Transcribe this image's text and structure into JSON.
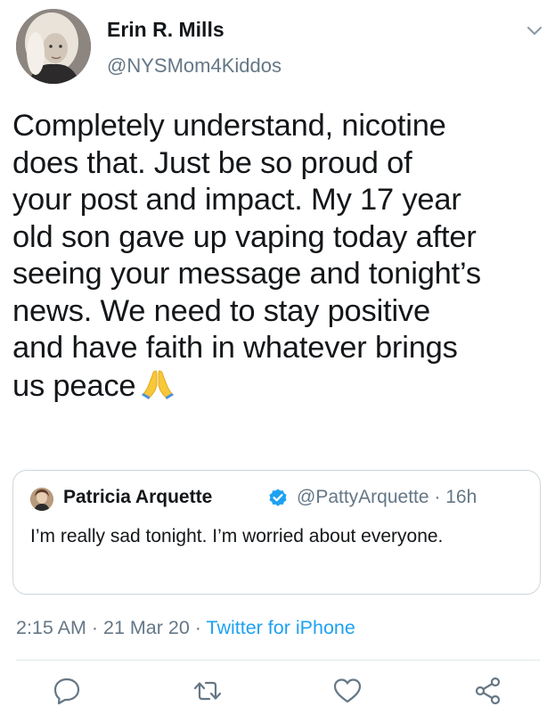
{
  "author": {
    "name": "Erin R. Mills",
    "handle": "@NYSMom4Kiddos"
  },
  "tweet": {
    "lines": [
      "Completely understand, nicotine",
      "does that. Just be so proud of",
      "your post and impact. My 17 year",
      "old son gave up vaping today after",
      "seeing your message and tonight’s",
      "news. We need to stay positive",
      "and have faith in whatever brings",
      "us peace"
    ],
    "emoji": "folded-hands"
  },
  "quoted_tweet": {
    "name": "Patricia Arquette",
    "handle_time": "@PattyArquette · 16h",
    "text": "I’m really sad tonight. I’m worried about everyone."
  },
  "meta": {
    "time_date": "2:15 AM · 21 Mar 20 · ",
    "source": "Twitter for iPhone"
  },
  "colors": {
    "text": "#14171a",
    "secondary": "#657786",
    "link": "#1da1f2",
    "border": "#ccd6dd"
  },
  "icons": [
    "chevron-down-icon",
    "verified-badge-icon",
    "reply-icon",
    "retweet-icon",
    "like-icon",
    "share-icon"
  ]
}
